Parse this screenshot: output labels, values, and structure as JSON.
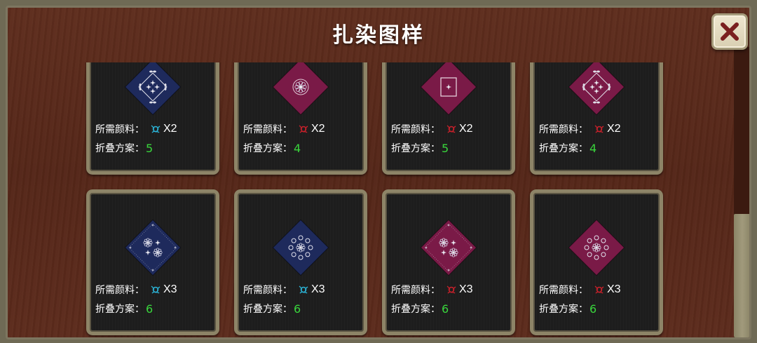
{
  "title": "扎染图样",
  "close_label": "✕",
  "labels": {
    "dye": "所需颜料：",
    "fold": "折叠方案："
  },
  "colors": {
    "indigo": "#1e2a5c",
    "magenta": "#7a1a47",
    "dye_cyan": "#2bb3d6",
    "dye_red": "#c8202a",
    "number_green": "#39d63c"
  },
  "cards": [
    {
      "pattern": "indigo-butterflies",
      "cloth": "indigo",
      "dye_icon": "cyan-dye-icon",
      "dye_count": "X2",
      "fold": "5"
    },
    {
      "pattern": "magenta-medallion",
      "cloth": "magenta",
      "dye_icon": "red-dye-icon",
      "dye_count": "X2",
      "fold": "4"
    },
    {
      "pattern": "magenta-frame",
      "cloth": "magenta",
      "dye_icon": "red-dye-icon",
      "dye_count": "X2",
      "fold": "5"
    },
    {
      "pattern": "magenta-butterflies",
      "cloth": "magenta",
      "dye_icon": "red-dye-icon",
      "dye_count": "X2",
      "fold": "4"
    },
    {
      "pattern": "indigo-flowers-corners",
      "cloth": "indigo",
      "dye_icon": "cyan-dye-icon",
      "dye_count": "X3",
      "fold": "6"
    },
    {
      "pattern": "indigo-rosette",
      "cloth": "indigo",
      "dye_icon": "cyan-dye-icon",
      "dye_count": "X3",
      "fold": "6"
    },
    {
      "pattern": "magenta-flowers-corners",
      "cloth": "magenta",
      "dye_icon": "red-dye-icon",
      "dye_count": "X3",
      "fold": "6"
    },
    {
      "pattern": "magenta-rosette",
      "cloth": "magenta",
      "dye_icon": "red-dye-icon",
      "dye_count": "X3",
      "fold": "6"
    }
  ]
}
